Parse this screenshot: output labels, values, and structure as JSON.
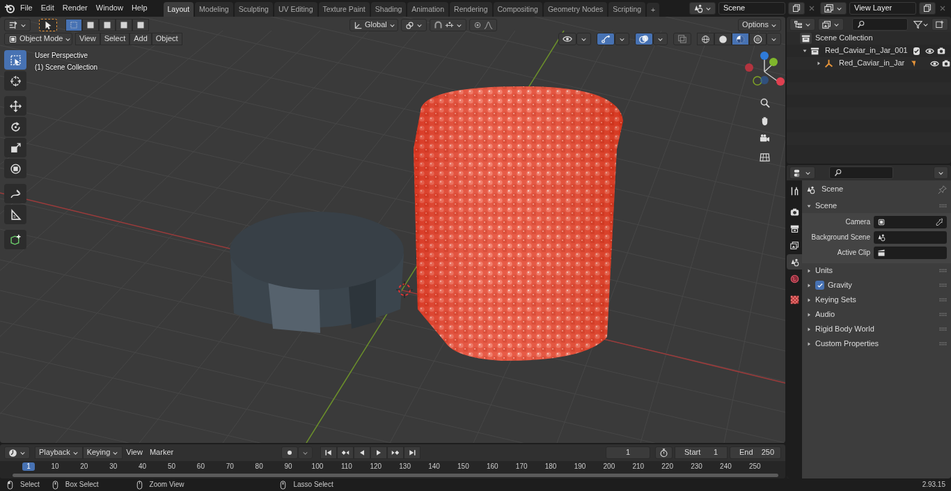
{
  "top_bar": {
    "menus": [
      "File",
      "Edit",
      "Render",
      "Window",
      "Help"
    ],
    "workspaces": [
      {
        "label": "Layout",
        "selected": true
      },
      {
        "label": "Modeling",
        "selected": false
      },
      {
        "label": "Sculpting",
        "selected": false
      },
      {
        "label": "UV Editing",
        "selected": false
      },
      {
        "label": "Texture Paint",
        "selected": false
      },
      {
        "label": "Shading",
        "selected": false
      },
      {
        "label": "Animation",
        "selected": false
      },
      {
        "label": "Rendering",
        "selected": false
      },
      {
        "label": "Compositing",
        "selected": false
      },
      {
        "label": "Geometry Nodes",
        "selected": false
      },
      {
        "label": "Scripting",
        "selected": false
      }
    ],
    "add_workspace": "+",
    "scene": "Scene",
    "view_layer": "View Layer"
  },
  "viewport": {
    "select_modes": [
      {
        "selected": true
      },
      {
        "selected": false
      },
      {
        "selected": false
      },
      {
        "selected": false
      },
      {
        "selected": false
      }
    ],
    "orientation": "Global",
    "options": "Options",
    "mode": "Object Mode",
    "menus": [
      "View",
      "Select",
      "Add",
      "Object"
    ],
    "toggles": [
      {
        "kind": "visibility",
        "on": false
      },
      {
        "kind": "gizmo",
        "on": true
      },
      {
        "kind": "overlay",
        "on": true
      },
      {
        "kind": "xray",
        "on": false
      }
    ],
    "shading": [
      {
        "kind": "wireframe",
        "selected": false
      },
      {
        "kind": "solid",
        "selected": false
      },
      {
        "kind": "material",
        "selected": true
      },
      {
        "kind": "rendered",
        "selected": false
      }
    ],
    "overlay_text": [
      "User Perspective",
      "(1) Scene Collection"
    ],
    "tools": [
      {
        "kind": "select",
        "selected": true
      },
      {
        "kind": "cursor",
        "selected": false
      },
      {
        "kind": "move",
        "selected": false
      },
      {
        "kind": "rotate",
        "selected": false
      },
      {
        "kind": "scale",
        "selected": false
      },
      {
        "kind": "transform",
        "selected": false
      },
      {
        "kind": "annotate",
        "selected": false
      },
      {
        "kind": "measure",
        "selected": false
      },
      {
        "kind": "add-cube",
        "selected": false
      }
    ]
  },
  "outliner": {
    "root": "Scene Collection",
    "items": [
      {
        "kind": "collection",
        "label": "Red_Caviar_in_Jar_001",
        "expanded": true,
        "checked": true,
        "children": [
          {
            "kind": "object",
            "label": "Red_Caviar_in_Jar",
            "expanded": false
          }
        ]
      }
    ]
  },
  "properties": {
    "tabs": [
      {
        "kind": "tool",
        "selected": false
      },
      {
        "kind": "render",
        "selected": false
      },
      {
        "kind": "output",
        "selected": false
      },
      {
        "kind": "view-layer",
        "selected": false
      },
      {
        "kind": "scene",
        "selected": true
      },
      {
        "kind": "world",
        "selected": false
      },
      {
        "kind": "texture",
        "selected": false
      }
    ],
    "context": "Scene",
    "panel": {
      "title": "Scene",
      "expanded": true,
      "fields": [
        {
          "kind": "camera",
          "label": "Camera"
        },
        {
          "kind": "scene",
          "label": "Background Scene"
        },
        {
          "kind": "clip",
          "label": "Active Clip"
        }
      ]
    },
    "sections": [
      {
        "kind": "plain",
        "label": "Units"
      },
      {
        "kind": "checkbox",
        "label": "Gravity",
        "checked": true
      },
      {
        "kind": "plain",
        "label": "Keying Sets"
      },
      {
        "kind": "plain",
        "label": "Audio"
      },
      {
        "kind": "plain",
        "label": "Rigid Body World"
      },
      {
        "kind": "plain",
        "label": "Custom Properties"
      }
    ]
  },
  "timeline": {
    "menus": [
      "Playback",
      "Keying",
      "View",
      "Marker"
    ],
    "current_frame": "1",
    "start_label": "Start",
    "start": "1",
    "end_label": "End",
    "end": "250",
    "playhead": "1",
    "ruler": [
      "10",
      "20",
      "30",
      "40",
      "50",
      "60",
      "70",
      "80",
      "90",
      "100",
      "110",
      "120",
      "130",
      "140",
      "150",
      "160",
      "170",
      "180",
      "190",
      "200",
      "210",
      "220",
      "230",
      "240",
      "250"
    ]
  },
  "status_bar": {
    "hints": [
      "Select",
      "Box Select",
      "Zoom View",
      "Lasso Select"
    ],
    "version": "2.93.15"
  }
}
